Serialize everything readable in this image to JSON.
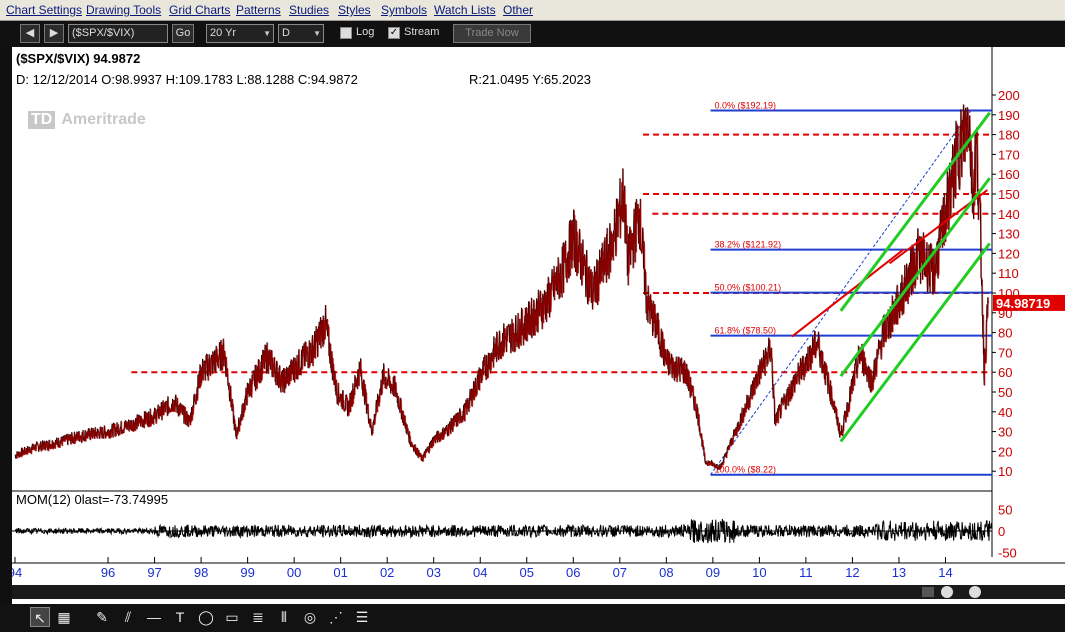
{
  "menu": [
    {
      "label": "Chart Settings"
    },
    {
      "label": "Drawing Tools"
    },
    {
      "label": "Grid Charts"
    },
    {
      "label": "Patterns"
    },
    {
      "label": "Studies"
    },
    {
      "label": "Styles"
    },
    {
      "label": "Symbols"
    },
    {
      "label": "Watch Lists"
    },
    {
      "label": "Other"
    }
  ],
  "toolbar": {
    "symbol": "($SPX/$VIX)",
    "go_label": "Go",
    "period": "20 Yr",
    "interval": "D",
    "log_label": "Log",
    "log_checked": false,
    "stream_label": "Stream",
    "stream_checked": true,
    "trade_now_label": "Trade Now"
  },
  "header": {
    "symbol_line": "($SPX/$VIX)  94.9872",
    "ohlc_line": "D:  12/12/2014  O:98.9937  H:109.1783  L:88.1288  C:94.9872",
    "ry_line": "R:21.0495  Y:65.2023",
    "watermark": "Ameritrade",
    "watermark_logo": "TD"
  },
  "colors": {
    "price": "#c00000",
    "bar": "#000000",
    "fib": "#1e3fd0",
    "resistance": "#e00000",
    "channel": "#22cc22",
    "trend": "#e00000",
    "axis_text": "#cc0000",
    "xaxis_text": "#1a2fd0",
    "last_price_bg": "#e00000"
  },
  "chart_data": {
    "type": "line",
    "title": "($SPX/$VIX)",
    "ylim": [
      0,
      200
    ],
    "y_ticks": [
      10,
      20,
      30,
      40,
      50,
      60,
      70,
      80,
      90,
      100,
      110,
      120,
      130,
      140,
      150,
      160,
      170,
      180,
      190,
      200
    ],
    "x_ticks": [
      "94",
      "96",
      "97",
      "98",
      "99",
      "00",
      "01",
      "02",
      "03",
      "04",
      "05",
      "06",
      "07",
      "08",
      "09",
      "10",
      "11",
      "12",
      "13",
      "14"
    ],
    "last_price": "94.98719",
    "series": [
      {
        "x": [
          "1994-01",
          "1994-06",
          "1995-01",
          "1995-06",
          "1996-01",
          "1996-06",
          "1997-01",
          "1997-06",
          "1997-10",
          "1998-01",
          "1998-07",
          "1998-10",
          "1999-01",
          "1999-06",
          "1999-10",
          "2000-01",
          "2000-06",
          "2000-09",
          "2000-12",
          "2001-03",
          "2001-06",
          "2001-09",
          "2001-12",
          "2002-03",
          "2002-07",
          "2002-10",
          "2003-01",
          "2003-04",
          "2003-09",
          "2004-01",
          "2004-06",
          "2004-10",
          "2005-01",
          "2005-06",
          "2005-10",
          "2006-01",
          "2006-06",
          "2006-11",
          "2007-02",
          "2007-03",
          "2007-06",
          "2007-08",
          "2007-11",
          "2008-01",
          "2008-06",
          "2008-09",
          "2008-11",
          "2009-03",
          "2009-09",
          "2010-01",
          "2010-04",
          "2010-05",
          "2010-10",
          "2011-04",
          "2011-08",
          "2011-10",
          "2012-03",
          "2012-06",
          "2012-09",
          "2013-01",
          "2013-06",
          "2013-10",
          "2014-01",
          "2014-04",
          "2014-06",
          "2014-07",
          "2014-08",
          "2014-09",
          "2014-10",
          "2014-11",
          "2014-12"
        ],
        "values": [
          18,
          22,
          25,
          28,
          30,
          33,
          38,
          45,
          35,
          60,
          70,
          28,
          50,
          68,
          55,
          62,
          72,
          85,
          50,
          42,
          62,
          30,
          58,
          52,
          25,
          16,
          26,
          30,
          40,
          58,
          75,
          80,
          85,
          95,
          110,
          128,
          100,
          125,
          150,
          115,
          140,
          95,
          80,
          65,
          60,
          40,
          15,
          12,
          40,
          60,
          72,
          35,
          55,
          75,
          45,
          28,
          70,
          55,
          80,
          95,
          120,
          110,
          140,
          170,
          180,
          192,
          150,
          175,
          130,
          60,
          95
        ]
      }
    ],
    "fib_levels": [
      {
        "label": "0.0%  ($192.19)",
        "value": 192.19
      },
      {
        "label": "38.2%  ($121.92)",
        "value": 121.92
      },
      {
        "label": "50.0%  ($100.21)",
        "value": 100.21
      },
      {
        "label": "61.8%  ($78.50)",
        "value": 78.5
      },
      {
        "label": "100.0%  ($8.22)",
        "value": 8.22
      }
    ],
    "resistance_levels": [
      180,
      150,
      140,
      100,
      60
    ],
    "momentum": {
      "label": "MOM(12)",
      "last_label": "0last=-73.74995",
      "ylim": [
        -60,
        60
      ],
      "y_ticks": [
        50,
        0,
        -50
      ]
    }
  }
}
